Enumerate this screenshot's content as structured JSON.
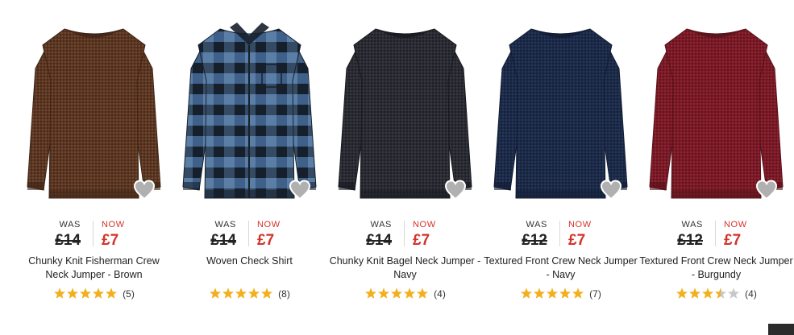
{
  "products": [
    {
      "was_label": "WAS",
      "was_price": "£14",
      "now_label": "NOW",
      "now_price": "£7",
      "title": "Chunky Knit Fisherman Crew Neck Jumper - Brown",
      "rating": 5,
      "review_count": "(5)",
      "image": "brown knit jumper",
      "garment": "jumper",
      "colors": {
        "main": "#5a3622",
        "dark": "#3e2416",
        "light": "#7a4e33"
      }
    },
    {
      "was_label": "WAS",
      "was_price": "£14",
      "now_label": "NOW",
      "now_price": "£7",
      "title": "Woven Check Shirt",
      "rating": 5,
      "review_count": "(8)",
      "image": "blue and black check shirt",
      "garment": "shirt",
      "colors": {
        "main": "#3b5d86",
        "dark": "#16202c",
        "light": "#5a7ea6"
      }
    },
    {
      "was_label": "WAS",
      "was_price": "£14",
      "now_label": "NOW",
      "now_price": "£7",
      "title": "Chunky Knit Bagel Neck Jumper - Navy",
      "rating": 5,
      "review_count": "(4)",
      "image": "navy knit jumper",
      "garment": "jumper",
      "colors": {
        "main": "#2a2b33",
        "dark": "#18191f",
        "light": "#3a3b45"
      }
    },
    {
      "was_label": "WAS",
      "was_price": "£12",
      "now_label": "NOW",
      "now_price": "£7",
      "title": "Textured Front Crew Neck Jumper - Navy",
      "rating": 5,
      "review_count": "(7)",
      "image": "navy textured jumper",
      "garment": "jumper",
      "colors": {
        "main": "#1c2a48",
        "dark": "#121c33",
        "light": "#2a3b60"
      }
    },
    {
      "was_label": "WAS",
      "was_price": "£12",
      "now_label": "NOW",
      "now_price": "£7",
      "title": "Textured Front Crew Neck Jumper - Burgundy",
      "rating": 3.5,
      "review_count": "(4)",
      "image": "burgundy textured jumper",
      "garment": "jumper",
      "colors": {
        "main": "#7a1a26",
        "dark": "#56111a",
        "light": "#952838"
      }
    }
  ],
  "icons": {
    "favourite": "heart-icon",
    "star": "star-icon"
  },
  "theme": {
    "sale_red": "#d4322a",
    "star_gold": "#f2b01e",
    "star_empty": "#c8c8c8",
    "heart_grey": "#b0b0b0"
  }
}
